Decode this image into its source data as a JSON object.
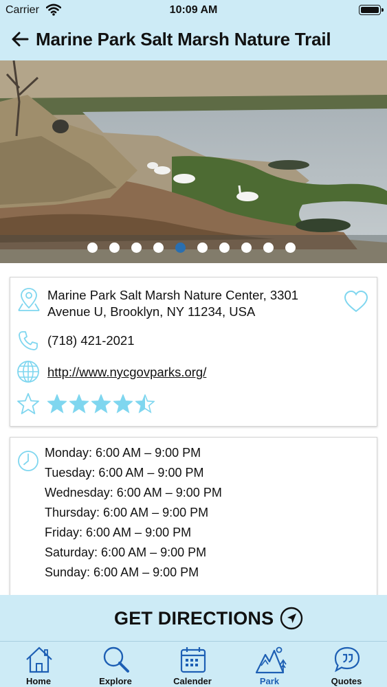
{
  "status_bar": {
    "carrier": "Carrier",
    "time": "10:09 AM"
  },
  "header": {
    "title": "Marine Park Salt Marsh Nature Trail"
  },
  "gallery": {
    "page_count": 10,
    "active_index": 4
  },
  "info": {
    "address": "Marine Park Salt Marsh Nature Center, 3301 Avenue U, Brooklyn, NY 11234, USA",
    "phone": "(718) 421-2021",
    "website": "http://www.nycgovparks.org/",
    "rating": 4.5,
    "rating_max": 5
  },
  "hours": [
    "Monday: 6:00 AM – 9:00 PM",
    "Tuesday: 6:00 AM – 9:00 PM",
    "Wednesday: 6:00 AM – 9:00 PM",
    "Thursday: 6:00 AM – 9:00 PM",
    "Friday: 6:00 AM – 9:00 PM",
    "Saturday: 6:00 AM – 9:00 PM",
    "Sunday: 6:00 AM – 9:00 PM"
  ],
  "directions": {
    "label": "GET DIRECTIONS"
  },
  "tabs": [
    {
      "label": "Home",
      "icon": "home-icon"
    },
    {
      "label": "Explore",
      "icon": "search-icon"
    },
    {
      "label": "Calender",
      "icon": "calendar-icon"
    },
    {
      "label": "Park",
      "icon": "park-icon"
    },
    {
      "label": "Quotes",
      "icon": "quotes-icon"
    }
  ],
  "colors": {
    "header_bg": "#cdebf6",
    "icon_accent": "#7fd6ef",
    "active_tab": "#1d5fb4",
    "active_dot": "#2a6fb0"
  }
}
